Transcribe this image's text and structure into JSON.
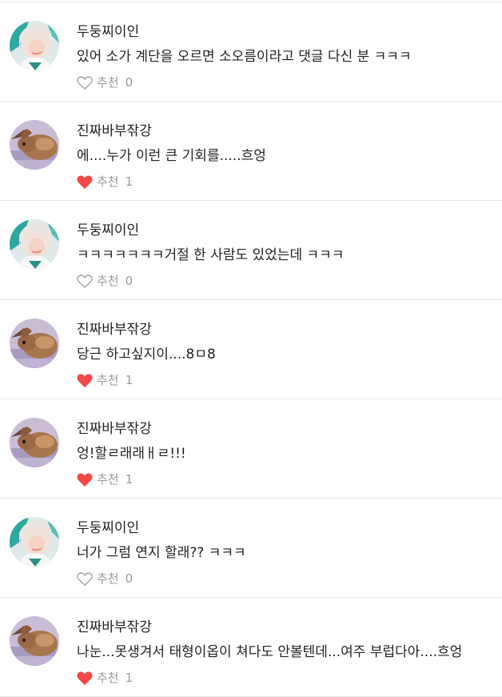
{
  "comments": [
    {
      "author": "두둥찌이인",
      "avatar": "girl",
      "text": "있어 소가 계단을 오르면 소오름이라고 댓글 다신 분 ㅋㅋㅋ",
      "like_label": "추천",
      "like_count": "0",
      "liked": false
    },
    {
      "author": "진짜바부잒강",
      "avatar": "rabbit",
      "text": "에....누가 이런 큰 기회를.....흐엉",
      "like_label": "추천",
      "like_count": "1",
      "liked": true
    },
    {
      "author": "두둥찌이인",
      "avatar": "girl",
      "text": "ㅋㅋㅋㅋㅋㅋㅋ거절 한 사람도 있었는데 ㅋㅋㅋ",
      "like_label": "추천",
      "like_count": "0",
      "liked": false
    },
    {
      "author": "진짜바부잒강",
      "avatar": "rabbit",
      "text": "당근 하고싶지이....8ㅁ8",
      "like_label": "추천",
      "like_count": "1",
      "liked": true
    },
    {
      "author": "진짜바부잒강",
      "avatar": "rabbit",
      "text": "엉!할ㄹ래래ㅐㄹ!!!",
      "like_label": "추천",
      "like_count": "1",
      "liked": true
    },
    {
      "author": "두둥찌이인",
      "avatar": "girl",
      "text": "너가 그럼 연지 할래?? ㅋㅋㅋ",
      "like_label": "추천",
      "like_count": "0",
      "liked": false
    },
    {
      "author": "진짜바부잒강",
      "avatar": "rabbit",
      "text": "나눈...못생겨서 태형이옵이 쳐다도 안볼텐데...여주 부럽다아....흐엉",
      "like_label": "추천",
      "like_count": "1",
      "liked": true
    }
  ],
  "colors": {
    "heart_liked": "#f24848",
    "heart_outline": "#9a9a9a",
    "text_muted": "#999999"
  }
}
